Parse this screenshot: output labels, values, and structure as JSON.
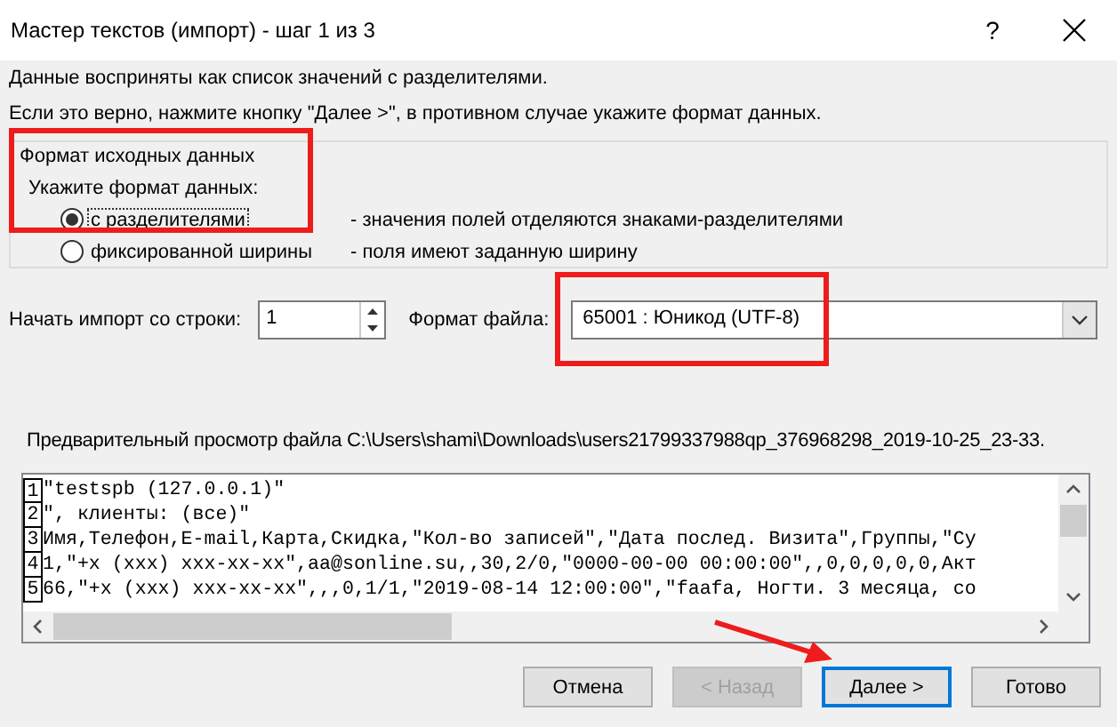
{
  "window": {
    "title": "Мастер текстов (импорт) - шаг 1 из 3",
    "help": "?"
  },
  "intro": [
    "Данные восприняты как список значений с разделителями.",
    "Если это верно, нажмите кнопку \"Далее >\", в противном случае укажите формат данных."
  ],
  "group": {
    "title": "Формат исходных данных",
    "prompt": "Укажите формат данных:",
    "options": [
      {
        "label": "с разделителями",
        "description": "- значения полей отделяются знаками-разделителями",
        "selected": true
      },
      {
        "label": "фиксированной ширины",
        "description": "- поля имеют заданную ширину",
        "selected": false
      }
    ]
  },
  "import": {
    "start_label": "Начать импорт со строки:",
    "start_value": "1",
    "format_label": "Формат файла:",
    "format_value": "65001 : Юникод (UTF-8)"
  },
  "preview": {
    "label": "Предварительный просмотр файла C:\\Users\\shami\\Downloads\\users21799337988qp_376968298_2019-10-25_23-33.",
    "lines": [
      {
        "number": "1",
        "text": "\"testspb (127.0.0.1)\""
      },
      {
        "number": "2",
        "text": "\", клиенты: (все)\""
      },
      {
        "number": "3",
        "text": "Имя,Телефон,E-mail,Карта,Скидка,\"Кол-во записей\",\"Дата послед. Визита\",Группы,\"Су"
      },
      {
        "number": "4",
        "text": "1,\"+x (xxx) xxx-xx-xx\",aa@sonline.su,,30,2/0,\"0000-00-00 00:00:00\",,0,0,0,0,0,Акт"
      },
      {
        "number": "5",
        "text": "66,\"+x (xxx) xxx-xx-xx\",,,0,1/1,\"2019-08-14 12:00:00\",\"faafa, Ногти. 3 месяца, со"
      }
    ]
  },
  "buttons": [
    {
      "label": "Отмена",
      "disabled": false,
      "default": false
    },
    {
      "label": "< Назад",
      "disabled": true,
      "default": false
    },
    {
      "label": "Далее >",
      "disabled": false,
      "default": true
    },
    {
      "label": "Готово",
      "disabled": false,
      "default": false
    }
  ],
  "annotations": [
    {
      "kind": "frame"
    },
    {
      "kind": "frame"
    },
    {
      "kind": "arrow"
    }
  ]
}
